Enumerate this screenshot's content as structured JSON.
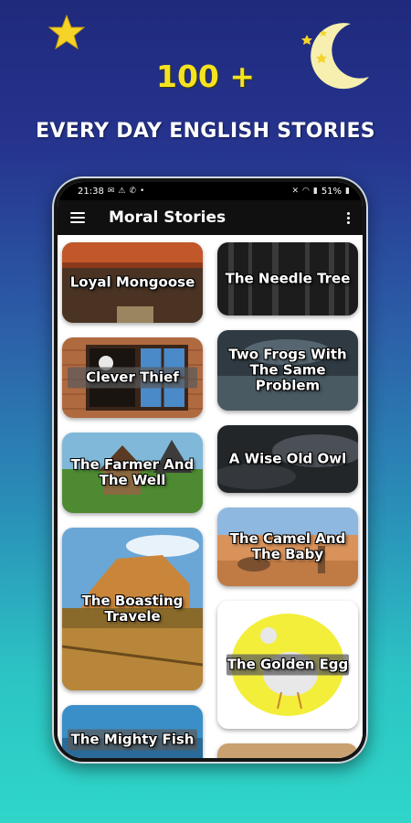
{
  "headline": {
    "count": "100 +",
    "tagline": "EVERY DAY ENGLISH STORIES"
  },
  "decor": {
    "star_color": "#f5d327",
    "moon_color": "#f6efb0"
  },
  "status_bar": {
    "time": "21:38",
    "left_icons": [
      "message-icon",
      "alert-icon",
      "call-icon",
      "whatsapp-icon",
      "dot-icon"
    ],
    "right_icons": [
      "mute-icon",
      "wifi-icon",
      "signal-icon",
      "battery-icon"
    ],
    "battery": "51%"
  },
  "app_bar": {
    "title": "Moral Stories",
    "menu_icon": "hamburger-menu-icon",
    "overflow_icon": "more-vert-icon"
  },
  "stories": {
    "left": [
      {
        "title": "Loyal Mongoose",
        "theme": "#b55a2a"
      },
      {
        "title": "Clever Thief",
        "theme": "#a9623a"
      },
      {
        "title": "The Farmer And The Well",
        "theme": "#5a8a3a"
      },
      {
        "title": "The Boasting Travele",
        "theme": "#c88a3a"
      },
      {
        "title": "The Mighty Fish",
        "theme": "#2a7aa8"
      }
    ],
    "right": [
      {
        "title": "The Needle Tree",
        "theme": "#2e2e2e"
      },
      {
        "title": "Two Frogs With The Same Problem",
        "theme": "#3c4a52"
      },
      {
        "title": "A Wise Old Owl",
        "theme": "#2a2e33"
      },
      {
        "title": "The Camel And The Baby",
        "theme": "#c9804a"
      },
      {
        "title": "The Golden Egg",
        "theme": "#f3ee3a"
      }
    ]
  }
}
